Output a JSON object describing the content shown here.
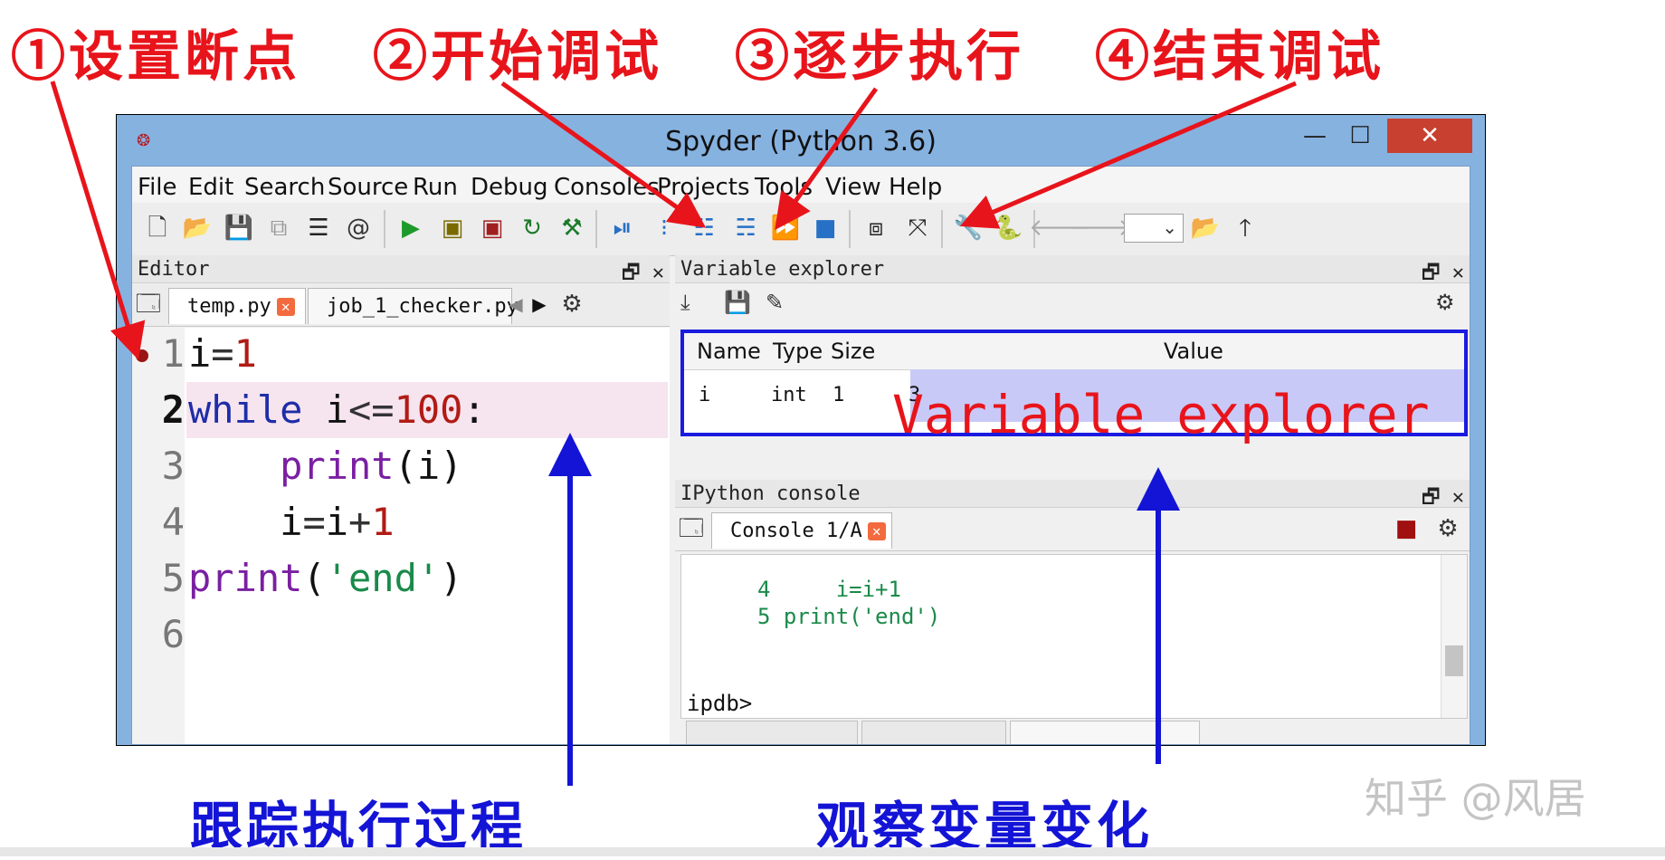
{
  "annotations": {
    "step1": "①设置断点",
    "step2": "②开始调试",
    "step3": "③逐步执行",
    "step4": "④结束调试",
    "trace": "跟踪执行过程",
    "observe": "观察变量变化",
    "watermark": "知乎 @风居"
  },
  "window": {
    "title": "Spyder (Python 3.6)",
    "minimize": "—",
    "maximize": "☐",
    "close": "✕"
  },
  "menu": [
    "File",
    "Edit",
    "Search",
    "Source",
    "Run",
    "Debug",
    "Consoles",
    "Projects",
    "Tools",
    "View",
    "Help"
  ],
  "editor": {
    "pane_title": "Editor",
    "tabs": [
      {
        "label": "temp.py"
      },
      {
        "label": "job_1_checker.py"
      }
    ],
    "line_numbers": [
      "1",
      "2",
      "3",
      "4",
      "5",
      "6"
    ],
    "current_line": "2"
  },
  "variable_explorer": {
    "pane_title": "Variable explorer",
    "columns": [
      "Name",
      "Type",
      "Size",
      "Value"
    ],
    "rows": [
      {
        "name": "i",
        "type": "int",
        "size": "1",
        "value": "3"
      }
    ],
    "overlay_label": "Variable explorer"
  },
  "console": {
    "pane_title": "IPython console",
    "tab": "Console 1/A",
    "lines": [
      "4     i=i+1",
      "5 print('end')"
    ],
    "prompt": "ipdb>"
  },
  "colors": {
    "annotation_red": "#e8141b",
    "annotation_blue": "#1414d6",
    "window_frame": "#86b2e0"
  }
}
